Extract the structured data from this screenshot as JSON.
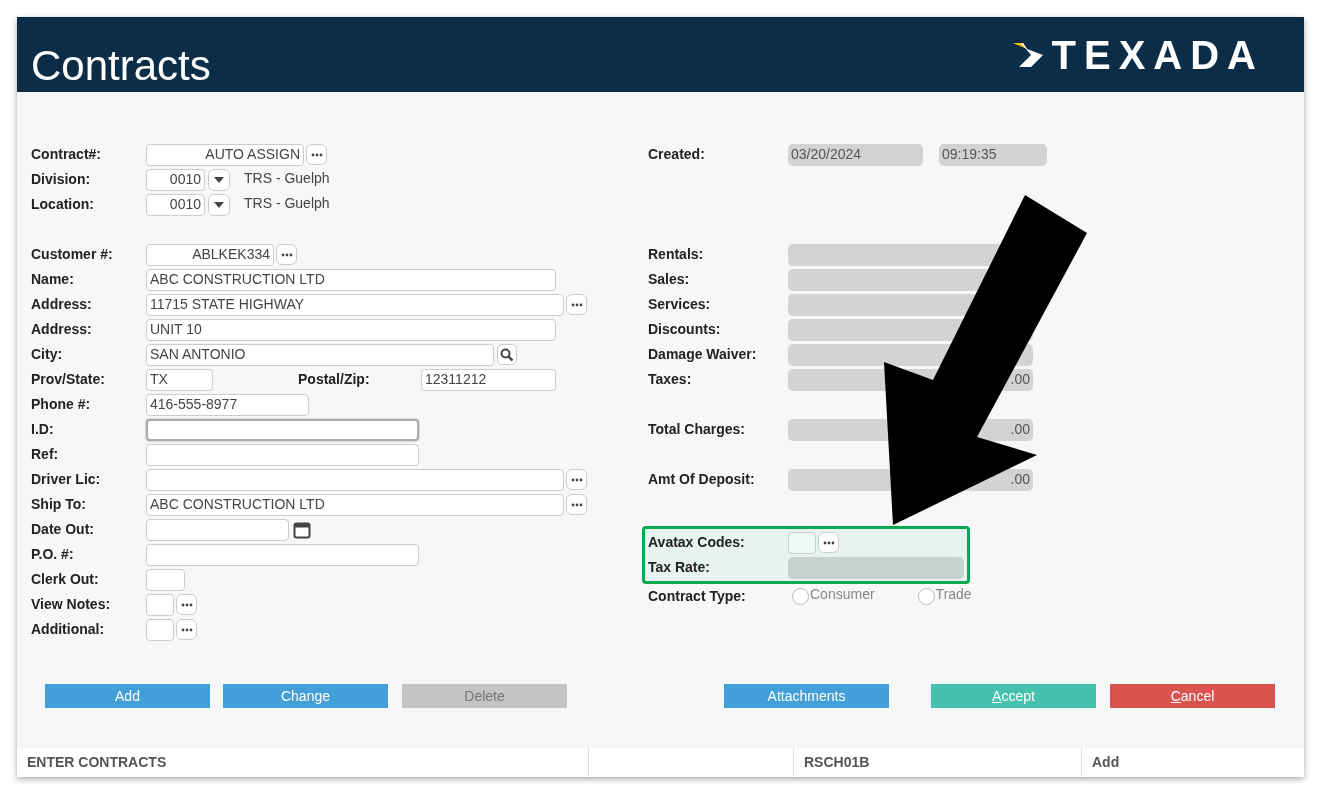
{
  "header": {
    "title": "Contracts",
    "logo_text": "TEXADA"
  },
  "left": {
    "sections": [
      {
        "rows": [
          {
            "label": "Contract#:",
            "value": "AUTO ASSIGN",
            "focused": false
          },
          {
            "label": "Division:",
            "value": "0010",
            "description": "TRS - Guelph",
            "focused": false
          },
          {
            "label": "Location:",
            "value": "0010",
            "description": "TRS - Guelph",
            "focused": false
          }
        ]
      },
      {
        "rows": [
          {
            "label": "Customer #:",
            "value": "ABLKEK334",
            "focused": false
          },
          {
            "label": "Name:",
            "value": "ABC CONSTRUCTION LTD",
            "focused": false
          },
          {
            "label": "Address:",
            "value": "11715 STATE HIGHWAY",
            "focused": false
          },
          {
            "label": "Address:",
            "value": "UNIT 10",
            "focused": false
          },
          {
            "label": "City:",
            "value": "SAN ANTONIO",
            "focused": false
          },
          {
            "label": "Prov/State:",
            "value": "TX",
            "second_label": "Postal/Zip:",
            "second_value": "12311212",
            "focused": false
          },
          {
            "label": "Phone #:",
            "value": "416-555-8977",
            "focused": false
          },
          {
            "label": "I.D:",
            "focused": true
          },
          {
            "label": "Ref:",
            "focused": false
          },
          {
            "label": "Driver Lic:",
            "focused": false
          },
          {
            "label": "Ship To:",
            "value": "ABC CONSTRUCTION LTD",
            "focused": false
          },
          {
            "label": "Date Out:",
            "focused": false
          },
          {
            "label": "P.O. #:",
            "focused": false
          },
          {
            "label": "Clerk Out:",
            "focused": false
          },
          {
            "label": "View Notes:",
            "focused": false
          },
          {
            "label": "Additional:",
            "focused": false
          }
        ]
      }
    ]
  },
  "right": {
    "created": {
      "label": "Created:",
      "date": "03/20/2024",
      "time": "09:19:35"
    },
    "totals": [
      {
        "label": "Rentals:"
      },
      {
        "label": "Sales:"
      },
      {
        "label": "Services:"
      },
      {
        "label": "Discounts:"
      },
      {
        "label": "Damage Waiver:"
      },
      {
        "label": "Taxes:",
        "value": ".00"
      },
      {
        "label": "Total Charges:",
        "value": ".00"
      },
      {
        "label": "Amt Of Deposit:",
        "value": ".00"
      }
    ],
    "tax": {
      "highlighted": true,
      "avatax_label": "Avatax Codes:",
      "rate_label": "Tax Rate:"
    },
    "contract_type": {
      "label": "Contract Type:",
      "options": [
        {
          "label": "Consumer",
          "selected": false
        },
        {
          "label": "Trade",
          "selected": false
        }
      ]
    }
  },
  "buttons": [
    {
      "label": "Add",
      "kind": "primary",
      "mnemonic": false
    },
    {
      "label": "Change",
      "kind": "primary",
      "mnemonic": false
    },
    {
      "label": "Delete",
      "kind": "disabled",
      "mnemonic": false
    },
    {
      "label": "Attachments",
      "kind": "primary",
      "mnemonic": false
    },
    {
      "label": "Accept",
      "kind": "success",
      "mnemonic": true
    },
    {
      "label": "Cancel",
      "kind": "danger",
      "mnemonic": true
    }
  ],
  "status_bar": [
    "ENTER CONTRACTS",
    "RSCH01B",
    "Add"
  ]
}
